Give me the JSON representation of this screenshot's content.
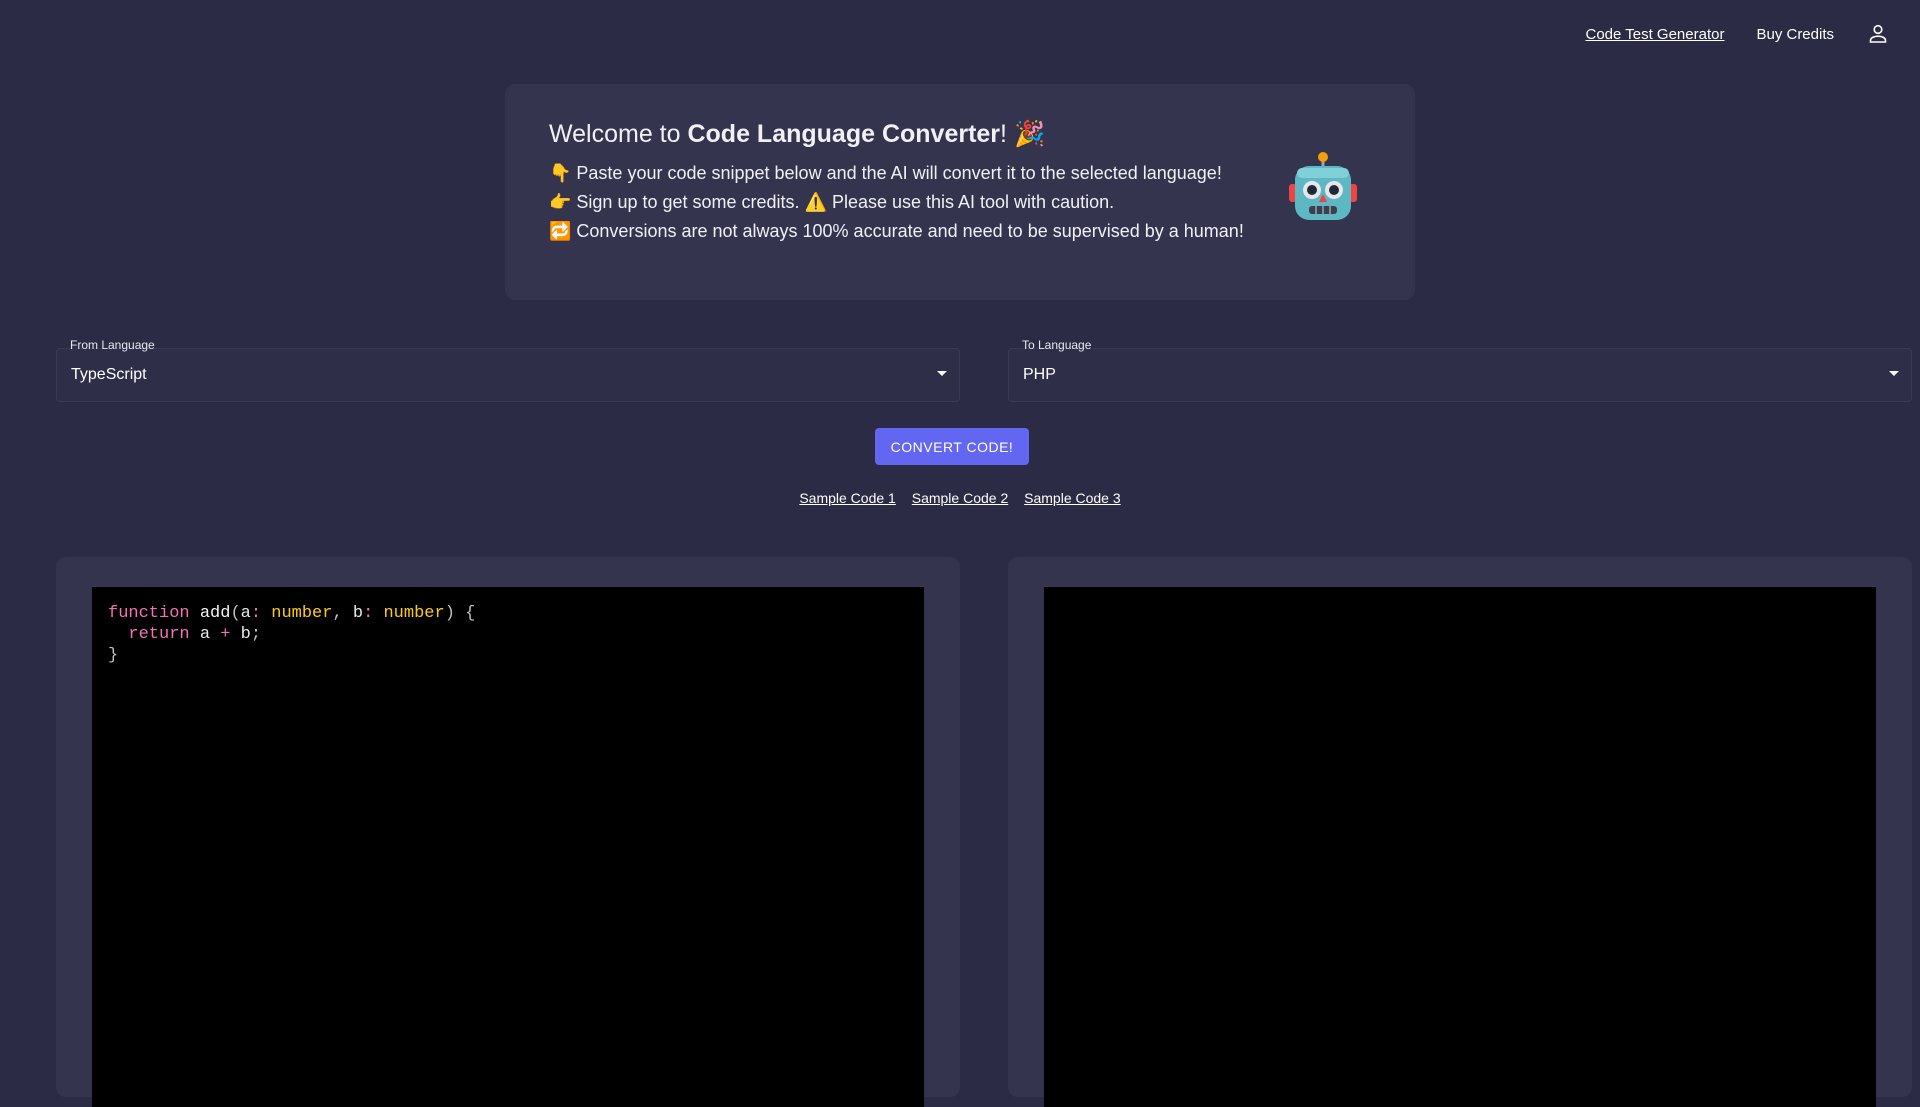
{
  "nav": {
    "code_test_generator": "Code Test Generator",
    "buy_credits": "Buy Credits",
    "user_icon": "user-icon"
  },
  "welcome": {
    "title_prefix": "Welcome to ",
    "title_bold": "Code Language Converter",
    "title_suffix": "! 🎉",
    "line1": "👇 Paste your code snippet below and the AI will convert it to the selected language!",
    "line2": "👉 Sign up to get some credits. ⚠️ Please use this AI tool with caution.",
    "line3": "🔁 Conversions are not always 100% accurate and need to be supervised by a human!",
    "robot_icon": "robot-icon"
  },
  "from_select": {
    "label": "From Language",
    "value": "TypeScript"
  },
  "to_select": {
    "label": "To Language",
    "value": "PHP"
  },
  "convert_button": "CONVERT CODE!",
  "samples": [
    "Sample Code 1",
    "Sample Code 2",
    "Sample Code 3"
  ],
  "input_code": {
    "lines": [
      "function add(a: number, b: number) {",
      "  return a + b;",
      "}"
    ]
  },
  "output_code": {
    "lines": []
  },
  "colors": {
    "background": "#2b2b45",
    "card": "#34344f",
    "accent": "#6366f1",
    "editor_bg": "#000000"
  }
}
